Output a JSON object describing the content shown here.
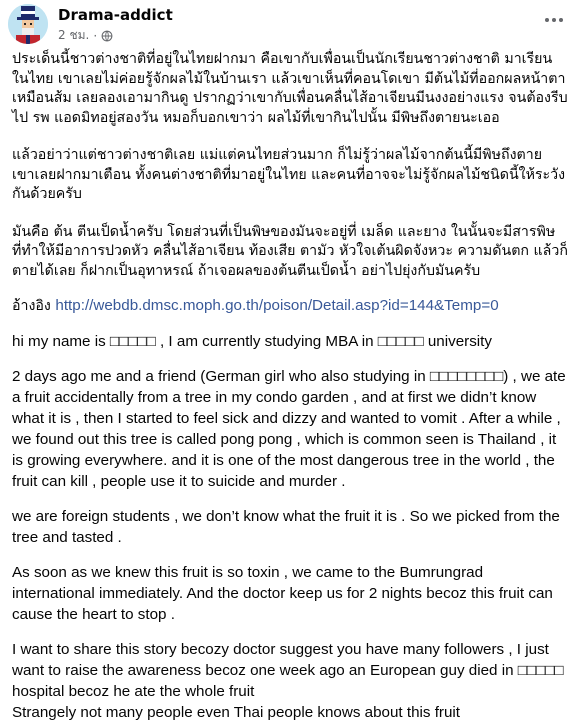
{
  "post": {
    "author": "Drama-addict",
    "time": "2 ชม.",
    "more_icon": "three-dots-horizontal",
    "privacy_icon": "globe-icon"
  },
  "content": {
    "p1": "ประเด็นนี้ชาวต่างชาติที่อยู่ในไทยฝากมา คือเขากับเพื่อนเป็นนักเรียนชาวต่างชาติ มาเรียนในไทย เขาเลยไม่ค่อยรู้จักผลไม้ในบ้านเรา แล้วเขาเห็นที่คอนโดเขา มีต้นไม้ที่ออกผลหน้าตาเหมือนส้ม เลยลองเอามากินดู ปรากฏว่าเขากับเพื่อนคลื่นไส้อาเจียนมีนงงอย่างแรง จนต้องรีบไป รพ แอดมิทอยู่สองวัน หมอก็บอกเขาว่า ผลไม้ที่เขากินไปนั้น มีพิษถึงตายนะเออ",
    "p2": "แล้วอย่าว่าแต่ชาวต่างชาติเลย แม่แต่คนไทยส่วนมาก ก็ไม่รู้ว่าผลไม้จากต้นนี้มีพิษถึงตาย เขาเลยฝากมาเตือน ทั้งคนต่างชาติที่มาอยู่ในไทย และคนที่อาจจะไม่รู้จักผลไม้ชนิดนี้ให้ระวังกันด้วยครับ",
    "p3": "มันคือ ต้น ตีนเป็ดน้ำครับ โดยส่วนที่เป็นพิษของมันจะอยู่ที่ เมล็ด และยาง ในนั้นจะมีสารพิษ ที่ทำให้มีอาการปวดหัว คลื่นไส้อาเจียน ท้องเสีย ตามัว หัวใจเต้นผิดจังหวะ ความดันตก แล้วก็ตายได้เลย ก็ฝากเป็นอุทาหรณ์ ถ้าเจอผลของต้นตีนเป็ดน้ำ อย่าไปยุ่งกับมันครับ",
    "ref_label": "อ้างอิง",
    "ref_url": "http://webdb.dmsc.moph.go.th/poison/Detail.asp?id=144&Temp=0",
    "e1": "hi my name is □□□□□ , I am currently studying MBA in  □□□□□ university",
    "e2": "2 days ago me and a friend (German girl who also studying in □□□□□□□□) , we ate a fruit accidentally from a tree in my condo garden , and at first we didn’t know what it is , then I started to feel sick and dizzy and wanted to vomit . After a while , we found out this tree is called pong pong , which is common seen is Thailand , it is growing everywhere. and it is one of the most dangerous tree in the world , the fruit can kill , people use it to suicide and murder .",
    "e3": "we are foreign students , we don’t know what the fruit it is . So we picked from the tree and tasted .",
    "e4": "As soon as we knew this fruit is so toxin , we came to the Bumrungrad international immediately. And the doctor keep us for 2 nights becoz this fruit can cause the heart to stop .",
    "e5": "I want to share this story becozy doctor suggest you have many followers , I just want to raise the awareness becoz one week ago an European guy died in □□□□□ hospital becoz he ate the whole fruit",
    "e6": "Strangely not many people even Thai people knows about this fruit"
  },
  "colors": {
    "text": "#050505",
    "meta": "#65676b",
    "link": "#385898"
  }
}
